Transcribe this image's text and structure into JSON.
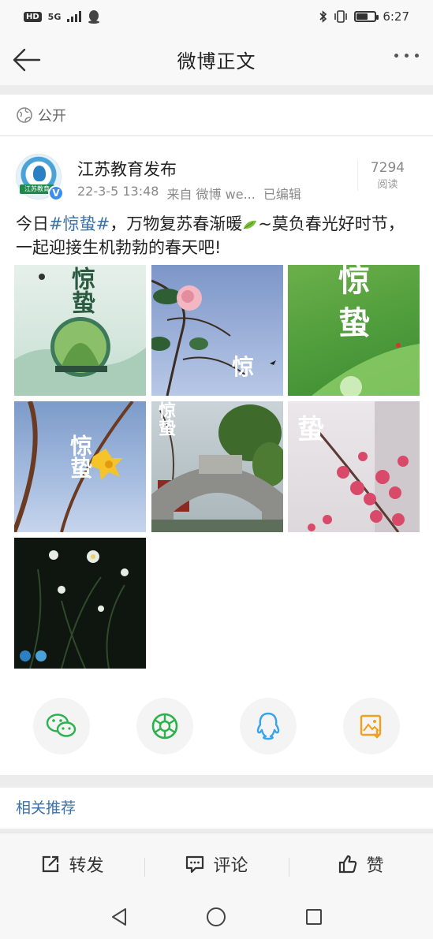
{
  "status_bar": {
    "hd": "HD",
    "network": "5G",
    "time": "6:27"
  },
  "nav": {
    "title": "微博正文"
  },
  "visibility": {
    "label": "公开"
  },
  "author": {
    "name": "江苏教育发布",
    "avatar_text": "江苏教育",
    "date": "22-3-5 13:48",
    "source": "来自 微博 we...",
    "edited": "已编辑",
    "reads_count": "7294",
    "reads_label": "阅读"
  },
  "post": {
    "prefix": "今日",
    "topic": "#惊蛰#",
    "after_topic": "，万物复苏春渐暖",
    "after_emoji": "~莫负春光好时节，一起迎接生机勃勃的春天吧!"
  },
  "images": {
    "img1_label": "惊蛰",
    "img3_label": "惊 蛰",
    "img4_label": "惊蛰",
    "img5_label": "惊蛰",
    "img6_label": "蛰"
  },
  "share": {
    "items": [
      "wechat-share",
      "moments-share",
      "qq-share",
      "save-image"
    ]
  },
  "related": {
    "label": "相关推荐"
  },
  "bottom_bar": {
    "repost": "转发",
    "comment": "评论",
    "like": "赞"
  },
  "colors": {
    "topic_link": "#3c71a8",
    "wechat_green": "#2bb24c",
    "qq_blue": "#38a3e8",
    "save_orange": "#f0a01e"
  }
}
